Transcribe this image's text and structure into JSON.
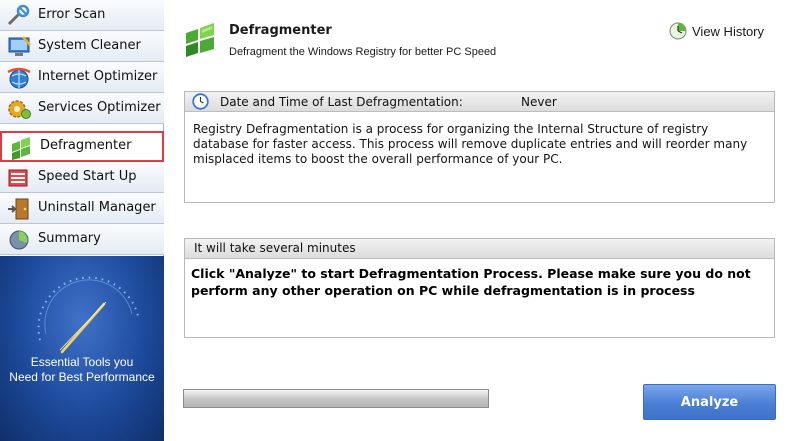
{
  "sidebar": {
    "items": [
      {
        "label": "Error Scan",
        "icon": "error-scan-icon"
      },
      {
        "label": "System Cleaner",
        "icon": "system-cleaner-icon"
      },
      {
        "label": "Internet Optimizer",
        "icon": "internet-optimizer-icon"
      },
      {
        "label": "Services Optimizer",
        "icon": "services-optimizer-icon"
      },
      {
        "label": "Defragmenter",
        "icon": "defragmenter-icon",
        "active": true
      },
      {
        "label": "Speed Start Up",
        "icon": "speed-start-up-icon"
      },
      {
        "label": "Uninstall Manager",
        "icon": "uninstall-manager-icon"
      },
      {
        "label": "Summary",
        "icon": "summary-icon"
      }
    ],
    "promo": {
      "line1": "Essential Tools you",
      "line2": "Need for Best Performance"
    }
  },
  "header": {
    "title": "Defragmenter",
    "subtitle": "Defragment the Windows Registry for better PC Speed",
    "view_history": "View History"
  },
  "last_defrag": {
    "label": "Date and Time of Last Defragmentation:",
    "value": "Never",
    "description": "Registry Defragmentation is a process for organizing the Internal Structure of registry database for faster access. This process will remove duplicate entries and will reorder many misplaced items to boost the overall performance of your PC."
  },
  "instructions": {
    "header": "It will take several minutes",
    "text": "Click \"Analyze\" to start Defragmentation Process. Please make sure you do not perform any other operation on PC while defragmentation is in process"
  },
  "progress": {
    "value": 0
  },
  "analyze_button": "Analyze",
  "colors": {
    "active_border": "#e03a45",
    "button_blue": "#4a7fd6",
    "promo_blue": "#1d4a9b"
  }
}
